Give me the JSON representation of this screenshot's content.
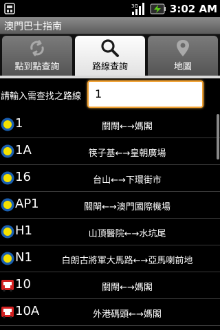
{
  "status_bar": {
    "time": "3:02 AM",
    "icons": [
      "notification-icon",
      "signal-icon",
      "battery-charging-icon"
    ],
    "signal_text": "3G"
  },
  "app": {
    "title": "澳門巴士指南"
  },
  "tabs": [
    {
      "label": "點到點查詢",
      "icon": "swap-arrows-icon",
      "active": false
    },
    {
      "label": "路線查詢",
      "icon": "search-icon",
      "active": true
    },
    {
      "label": "地圖",
      "icon": "map-pin-icon",
      "active": false
    }
  ],
  "search": {
    "label": "請輸入需查找之路線",
    "value": "1"
  },
  "routes": [
    {
      "number": "1",
      "desc": "關閘←→媽閣",
      "type": "day"
    },
    {
      "number": "1A",
      "desc": "筷子基←→皇朝廣場",
      "type": "day"
    },
    {
      "number": "16",
      "desc": "台山←→下環街市",
      "type": "day"
    },
    {
      "number": "AP1",
      "desc": "關閘←→澳門國際機場",
      "type": "day"
    },
    {
      "number": "H1",
      "desc": "山頂醫院←→水坑尾",
      "type": "day"
    },
    {
      "number": "N1",
      "desc": "白朗古將軍大馬路←→亞馬喇前地",
      "type": "night"
    },
    {
      "number": "10",
      "desc": "關閘←→媽閣",
      "type": "tmacau"
    },
    {
      "number": "10A",
      "desc": "外港碼頭←→媽閣",
      "type": "tmacau"
    }
  ],
  "colors": {
    "accent_orange": "#f0a030",
    "bus_blue": "#1a5fb0",
    "bus_yellow": "#f5e200",
    "bus_red": "#d32020"
  }
}
